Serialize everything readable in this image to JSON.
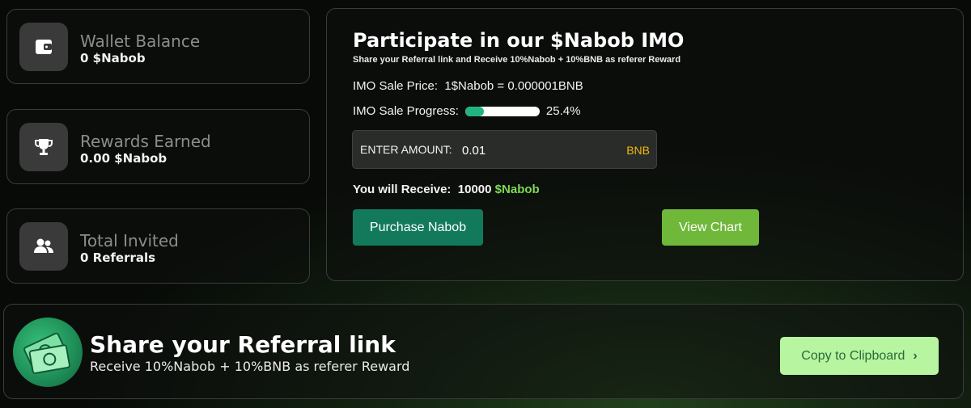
{
  "stats": {
    "wallet": {
      "title": "Wallet Balance",
      "value": "0 $Nabob",
      "icon": "wallet-icon"
    },
    "rewards": {
      "title": "Rewards Earned",
      "value": "0.00 $Nabob",
      "icon": "trophy-icon"
    },
    "invited": {
      "title": "Total Invited",
      "value": "0 Referrals",
      "icon": "users-icon"
    }
  },
  "imo": {
    "title": "Participate in our $Nabob IMO",
    "subtitle": "Share your Referral link and Receive 10%Nabob + 10%BNB as referer Reward",
    "price_label": "IMO Sale Price:",
    "price_value": "1$Nabob = 0.000001BNB",
    "progress_label": "IMO Sale Progress:",
    "progress_percent": 25.4,
    "progress_text": "25.4%",
    "amount_label": "ENTER AMOUNT:",
    "amount_value": "0.01",
    "amount_unit": "BNB",
    "receive_label": "You will Receive:",
    "receive_amount": "10000",
    "receive_token": "$Nabob",
    "purchase_label": "Purchase Nabob",
    "chart_label": "View Chart"
  },
  "referral": {
    "title": "Share your Referral link",
    "subtitle": "Receive 10%Nabob + 10%BNB as referer Reward",
    "copy_label": "Copy to Clipboard",
    "logo_icon": "money-stack-icon"
  },
  "colors": {
    "accent_green": "#7ed957",
    "purchase_btn": "#127a5a",
    "chart_btn": "#6fb83a",
    "copy_btn": "#b7f5a0",
    "bnb": "#f0b90b",
    "progress": "#22b480"
  }
}
